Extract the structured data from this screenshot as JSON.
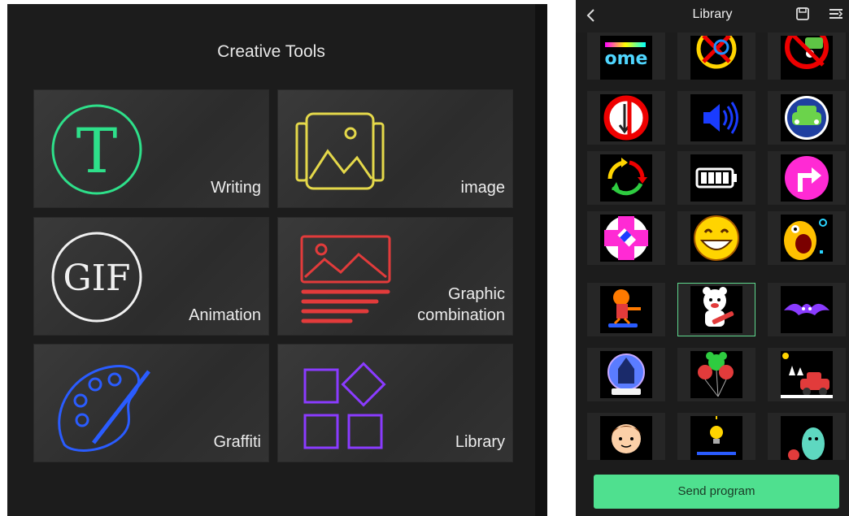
{
  "left": {
    "title": "Creative Tools",
    "tiles": [
      {
        "label": "Writing",
        "icon": "letter-t-icon",
        "color": "#2ee08a",
        "glyph": "T"
      },
      {
        "label": "image",
        "icon": "image-icon",
        "color": "#e4d84a"
      },
      {
        "label": "Animation",
        "icon": "gif-icon",
        "color": "#f0f0f0",
        "glyph": "GIF"
      },
      {
        "label": "Graphic\ncombination",
        "label_line1": "Graphic",
        "label_line2": "combination",
        "icon": "graphic-combination-icon",
        "color": "#e23b3b"
      },
      {
        "label": "Graffiti",
        "icon": "palette-icon",
        "color": "#2a5cff"
      },
      {
        "label": "Library",
        "icon": "shapes-icon",
        "color": "#8a3bff"
      }
    ]
  },
  "right": {
    "title": "Library",
    "icons": {
      "back": "chevron-left-icon",
      "save": "save-icon",
      "menu": "menu-icon"
    },
    "send_button": "Send program",
    "accent": "#4fe08f",
    "grid": [
      [
        "welcome-text-clip",
        "no-cycling-sign",
        "no-car-sign"
      ],
      [
        "no-down-arrow-sign",
        "speaker-sign",
        "car-front-sign"
      ],
      [
        "recycle-arrows",
        "battery",
        "turn-right-sign"
      ],
      [
        "first-aid-cross",
        "grinning-emoji",
        "yellow-monster"
      ],
      [
        "orange-skater",
        "bear-with-guitar",
        "purple-bat"
      ],
      [
        "castle-snow-globe",
        "mickey-balloons",
        "red-car-scene"
      ],
      [
        "cartoon-boy",
        "light-bulb",
        "green-creature"
      ]
    ],
    "selected_cell": "bear-with-guitar",
    "welcome_text": "ome"
  }
}
